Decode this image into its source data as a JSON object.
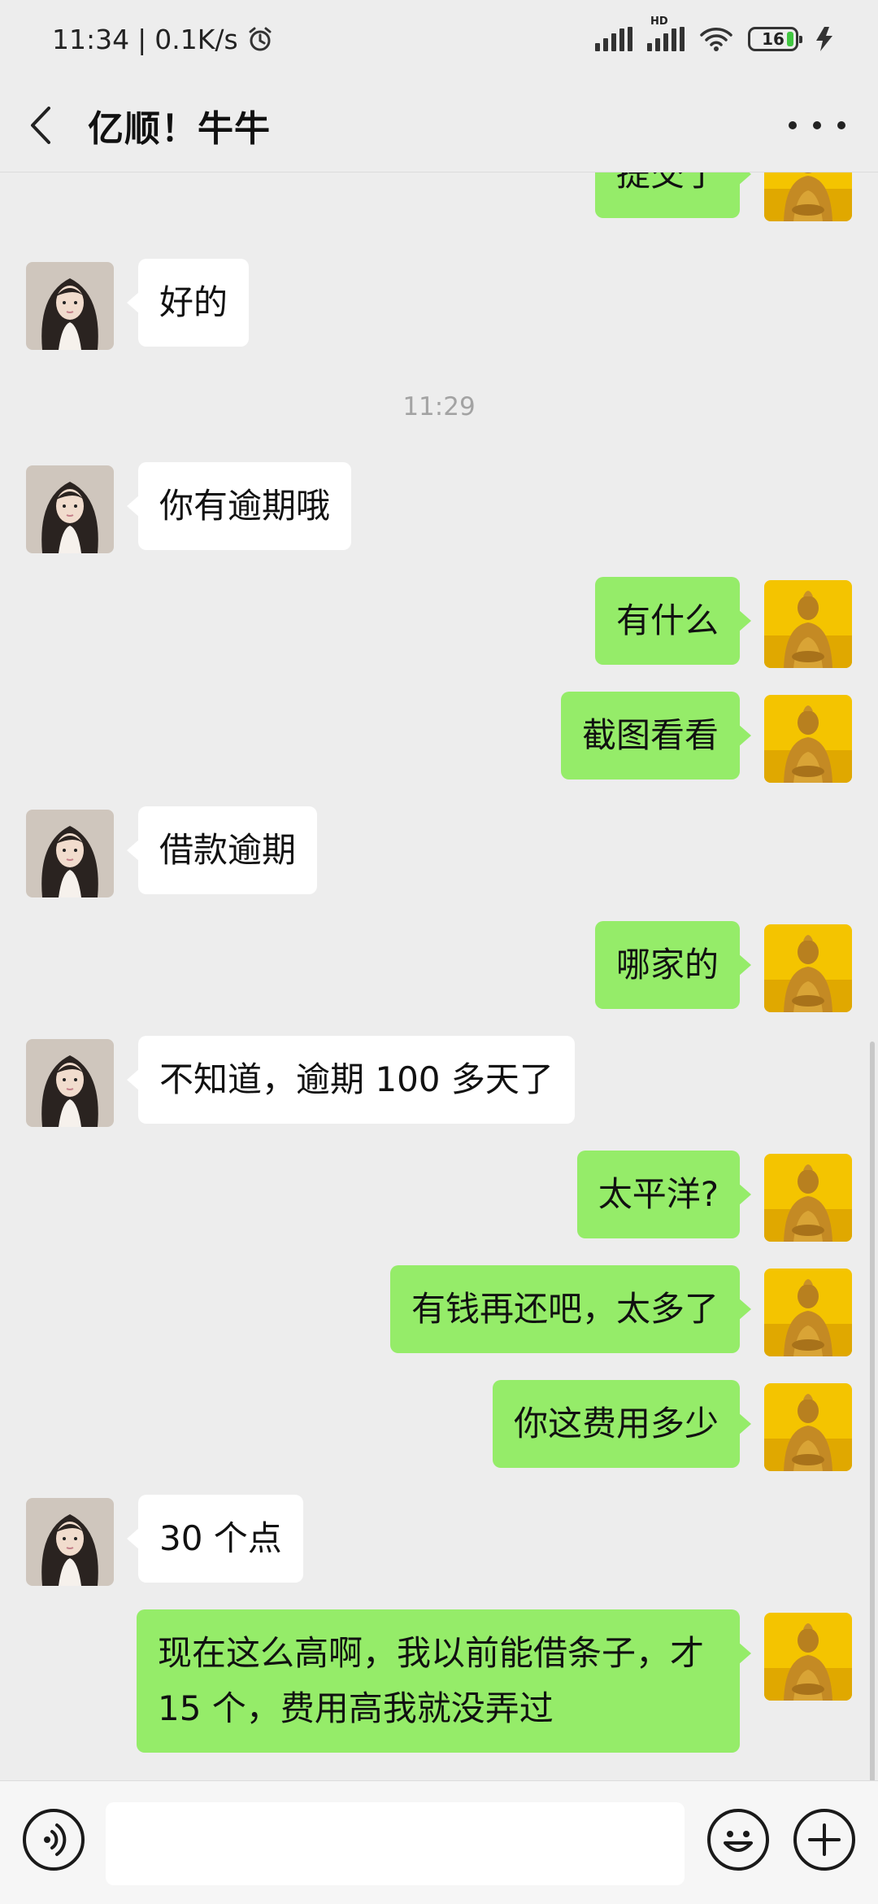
{
  "status_bar": {
    "time": "11:34",
    "separator": "|",
    "net_speed": "0.1K/s",
    "hd_label": "HD",
    "battery_level": "16",
    "icons": [
      "alarm-icon",
      "signal-icon",
      "hd-signal-icon",
      "wifi-icon",
      "battery-icon",
      "charging-icon"
    ]
  },
  "header": {
    "title": "亿顺！牛牛",
    "icons": [
      "back-arrow-icon",
      "more-icon"
    ]
  },
  "messages": [
    {
      "side": "right",
      "text": "提交了"
    },
    {
      "side": "left",
      "text": "好的"
    },
    {
      "type": "time",
      "text": "11:29"
    },
    {
      "side": "left",
      "text": "你有逾期哦"
    },
    {
      "side": "right",
      "text": "有什么"
    },
    {
      "side": "right",
      "text": "截图看看"
    },
    {
      "side": "left",
      "text": "借款逾期"
    },
    {
      "side": "right",
      "text": "哪家的"
    },
    {
      "side": "left",
      "text": "不知道，逾期 100 多天了"
    },
    {
      "side": "right",
      "text": "太平洋?"
    },
    {
      "side": "right",
      "text": "有钱再还吧，太多了"
    },
    {
      "side": "right",
      "text": "你这费用多少"
    },
    {
      "side": "left",
      "text": "30 个点"
    },
    {
      "side": "right",
      "text": "现在这么高啊，我以前能借条子，才 15 个，费用高我就没弄过"
    }
  ],
  "input_bar": {
    "icons": [
      "voice-icon",
      "emoji-icon",
      "plus-icon"
    ]
  },
  "colors": {
    "background": "#ededed",
    "my_bubble": "#95ec69",
    "their_bubble": "#ffffff"
  }
}
